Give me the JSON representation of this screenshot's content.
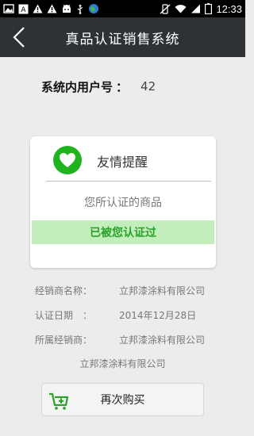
{
  "status_bar": {
    "time": "12:33",
    "battery_level": "2"
  },
  "header": {
    "title": "真品认证销售系统"
  },
  "user": {
    "label": "系统内用户号",
    "separator": "：",
    "value": "42"
  },
  "card": {
    "title": "友情提醒",
    "subtitle": "您所认证的商品",
    "status": "已被您认证过",
    "icon_color": "#1fb31f",
    "status_bg": "#c3eebb",
    "status_color": "#2aa22a"
  },
  "info": {
    "dealer_label": "经销商名称：",
    "dealer_value": "立邦漆涂料有限公司",
    "date_label": "认证日期　：",
    "date_value": "2014年12月28日",
    "owner_label": "所属经销商：",
    "owner_value": "立邦漆涂料有限公司",
    "footer": "立邦漆涂料有限公司"
  },
  "action": {
    "buy_again_label": "再次购买"
  },
  "colors": {
    "header_bg": "#2d3236",
    "page_bg": "#ececec"
  }
}
